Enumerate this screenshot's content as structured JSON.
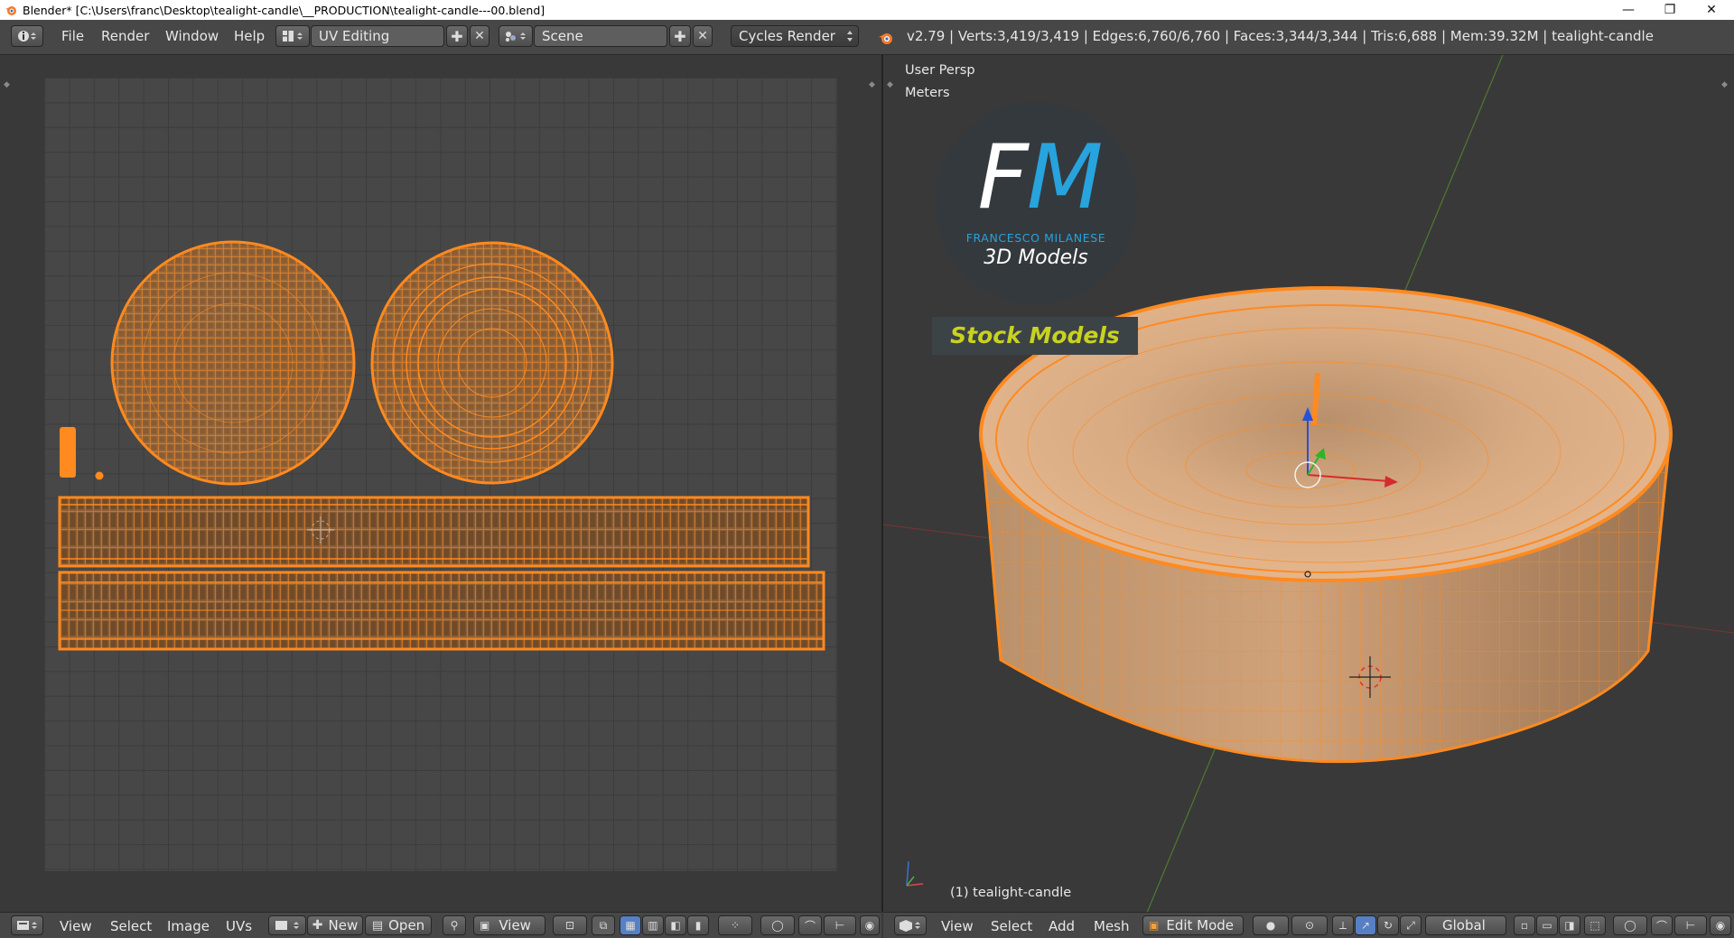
{
  "window": {
    "title": "Blender* [C:\\Users\\franc\\Desktop\\tealight-candle\\__PRODUCTION\\tealight-candle---00.blend]",
    "minimize": "—",
    "restore": "❐",
    "close": "✕"
  },
  "info_header": {
    "menus": [
      "File",
      "Render",
      "Window",
      "Help"
    ],
    "screen_layout": "UV Editing",
    "scene": "Scene",
    "render_engine": "Cycles Render",
    "status": "v2.79 | Verts:3,419/3,419 | Edges:6,760/6,760 | Faces:3,344/3,344 | Tris:6,688 | Mem:39.32M | tealight-candle"
  },
  "viewport": {
    "view_name": "User Persp",
    "units": "Meters",
    "object_label": "(1) tealight-candle",
    "watermark": {
      "initials_f": "F",
      "initials_m": "M",
      "brand": "FRANCESCO MILANESE",
      "subtitle": "3D Models",
      "ribbon": "Stock Models"
    }
  },
  "uv_footer": {
    "menus": [
      "View",
      "Select",
      "Image",
      "UVs"
    ],
    "new_label": "New",
    "open_label": "Open",
    "view_label": "View"
  },
  "view3d_footer": {
    "menus": [
      "View",
      "Select",
      "Add",
      "Mesh"
    ],
    "mode": "Edit Mode",
    "orientation": "Global"
  },
  "colors": {
    "accent_orange": "#ff8a1f",
    "selection_fill": "#9a6a3c",
    "ui_dark": "#393939",
    "header": "#474747",
    "watermark_blue": "#27a3dd",
    "watermark_yellow": "#c9d21e"
  }
}
